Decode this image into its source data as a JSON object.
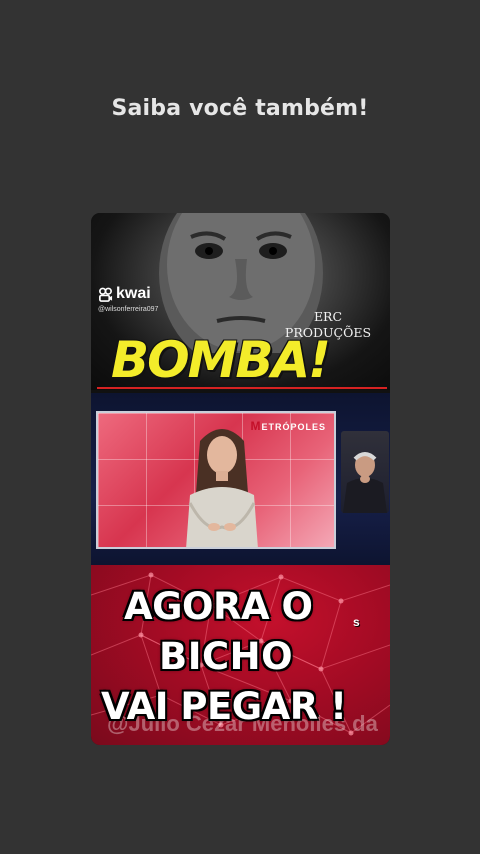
{
  "caption": "Saiba você também!",
  "top_panel": {
    "brand": "kwai",
    "username": "@wilsonferreira097",
    "credit_line1": "ERC",
    "credit_line2": "PRODUÇÕES",
    "headline": "BOMBA!"
  },
  "mid_panel": {
    "channel_logo_letter": "M",
    "channel_logo_rest": "ETRÓPOLES"
  },
  "bottom_panel": {
    "line1": "AGORA O",
    "line1_suffix": "s",
    "line2": "BICHO",
    "line3": "VAI PEGAR !",
    "watermark": "@Julio Cezar Menolles da"
  },
  "colors": {
    "background": "#333333",
    "bomba_yellow": "#f3ec2a",
    "bottom_red": "#a30b24"
  }
}
